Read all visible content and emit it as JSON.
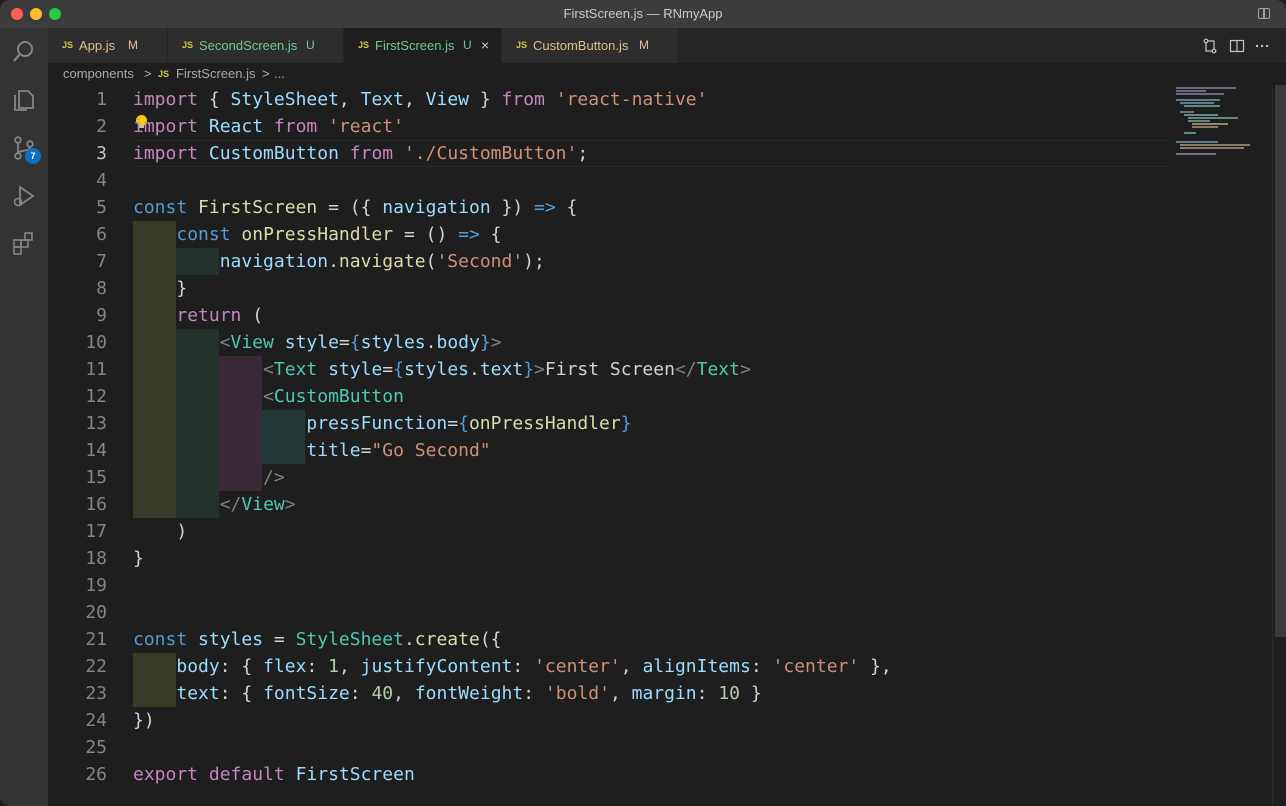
{
  "window": {
    "title": "FirstScreen.js — RNmyApp"
  },
  "activity_bar": {
    "scm_badge": "7"
  },
  "tabs": [
    {
      "icon": "JS",
      "name": "App.js",
      "status": "M",
      "name_color": "#e2c08d",
      "active": false
    },
    {
      "icon": "JS",
      "name": "SecondScreen.js",
      "status": "U",
      "name_color": "#73c991",
      "active": false
    },
    {
      "icon": "JS",
      "name": "FirstScreen.js",
      "status": "U",
      "name_color": "#73c991",
      "active": true,
      "close": "×"
    },
    {
      "icon": "JS",
      "name": "CustomButton.js",
      "status": "M",
      "name_color": "#e2c08d",
      "active": false
    }
  ],
  "breadcrumb": {
    "folder": "components",
    "sep": ">",
    "file_icon": "JS",
    "file": "FirstScreen.js",
    "ellipsis": "..."
  },
  "editor": {
    "current_line": 3,
    "line_numbers": [
      "1",
      "2",
      "3",
      "4",
      "5",
      "6",
      "7",
      "8",
      "9",
      "10",
      "11",
      "12",
      "13",
      "14",
      "15",
      "16",
      "17",
      "18",
      "19",
      "20",
      "21",
      "22",
      "23",
      "24",
      "25",
      "26"
    ],
    "lines": [
      [
        [
          "kw",
          "import"
        ],
        [
          "p",
          " { "
        ],
        [
          "var",
          "StyleSheet"
        ],
        [
          "p",
          ", "
        ],
        [
          "var",
          "Text"
        ],
        [
          "p",
          ", "
        ],
        [
          "var",
          "View"
        ],
        [
          "p",
          " } "
        ],
        [
          "kw",
          "from"
        ],
        [
          "p",
          " "
        ],
        [
          "str",
          "'react-native'"
        ]
      ],
      [
        [
          "kw",
          "import"
        ],
        [
          "p",
          " "
        ],
        [
          "var",
          "React"
        ],
        [
          "p",
          " "
        ],
        [
          "kw",
          "from"
        ],
        [
          "p",
          " "
        ],
        [
          "str",
          "'react'"
        ]
      ],
      [
        [
          "kw",
          "import"
        ],
        [
          "p",
          " "
        ],
        [
          "var",
          "CustomButton"
        ],
        [
          "p",
          " "
        ],
        [
          "kw",
          "from"
        ],
        [
          "p",
          " "
        ],
        [
          "str",
          "'./CustomButton'"
        ],
        [
          "p",
          ";"
        ]
      ],
      [],
      [
        [
          "decl",
          "const"
        ],
        [
          "p",
          " "
        ],
        [
          "fn",
          "FirstScreen"
        ],
        [
          "p",
          " = ({ "
        ],
        [
          "var",
          "navigation"
        ],
        [
          "p",
          " }) "
        ],
        [
          "decl",
          "=>"
        ],
        [
          "p",
          " {"
        ]
      ],
      [
        [
          "p",
          "    "
        ],
        [
          "decl",
          "const"
        ],
        [
          "p",
          " "
        ],
        [
          "fn",
          "onPressHandler"
        ],
        [
          "p",
          " = () "
        ],
        [
          "decl",
          "=>"
        ],
        [
          "p",
          " {"
        ]
      ],
      [
        [
          "p",
          "        "
        ],
        [
          "var",
          "navigation"
        ],
        [
          "p",
          "."
        ],
        [
          "fn",
          "navigate"
        ],
        [
          "p",
          "("
        ],
        [
          "str",
          "'Second'"
        ],
        [
          "p",
          ");"
        ]
      ],
      [
        [
          "p",
          "    }"
        ]
      ],
      [
        [
          "p",
          "    "
        ],
        [
          "kw",
          "return"
        ],
        [
          "p",
          " ("
        ]
      ],
      [
        [
          "p",
          "        "
        ],
        [
          "brk",
          "<"
        ],
        [
          "tag",
          "View"
        ],
        [
          "p",
          " "
        ],
        [
          "var",
          "style"
        ],
        [
          "p",
          "="
        ],
        [
          "jsb",
          "{"
        ],
        [
          "var",
          "styles"
        ],
        [
          "p",
          "."
        ],
        [
          "var",
          "body"
        ],
        [
          "jsb",
          "}"
        ],
        [
          "brk",
          ">"
        ]
      ],
      [
        [
          "p",
          "            "
        ],
        [
          "brk",
          "<"
        ],
        [
          "tag",
          "Text"
        ],
        [
          "p",
          " "
        ],
        [
          "var",
          "style"
        ],
        [
          "p",
          "="
        ],
        [
          "jsb",
          "{"
        ],
        [
          "var",
          "styles"
        ],
        [
          "p",
          "."
        ],
        [
          "var",
          "text"
        ],
        [
          "jsb",
          "}"
        ],
        [
          "brk",
          ">"
        ],
        [
          "p",
          "First Screen"
        ],
        [
          "brk",
          "</"
        ],
        [
          "tag",
          "Text"
        ],
        [
          "brk",
          ">"
        ]
      ],
      [
        [
          "p",
          "            "
        ],
        [
          "brk",
          "<"
        ],
        [
          "tag",
          "CustomButton"
        ]
      ],
      [
        [
          "p",
          "                "
        ],
        [
          "var",
          "pressFunction"
        ],
        [
          "p",
          "="
        ],
        [
          "jsb",
          "{"
        ],
        [
          "fn",
          "onPressHandler"
        ],
        [
          "jsb",
          "}"
        ]
      ],
      [
        [
          "p",
          "                "
        ],
        [
          "var",
          "title"
        ],
        [
          "p",
          "="
        ],
        [
          "str",
          "\"Go Second\""
        ]
      ],
      [
        [
          "p",
          "            "
        ],
        [
          "brk",
          "/>"
        ]
      ],
      [
        [
          "p",
          "        "
        ],
        [
          "brk",
          "</"
        ],
        [
          "tag",
          "View"
        ],
        [
          "brk",
          ">"
        ]
      ],
      [
        [
          "p",
          "    )"
        ]
      ],
      [
        [
          "p",
          "}"
        ]
      ],
      [],
      [],
      [
        [
          "decl",
          "const"
        ],
        [
          "p",
          " "
        ],
        [
          "var",
          "styles"
        ],
        [
          "p",
          " = "
        ],
        [
          "cls",
          "StyleSheet"
        ],
        [
          "p",
          "."
        ],
        [
          "fn",
          "create"
        ],
        [
          "p",
          "({"
        ]
      ],
      [
        [
          "p",
          "    "
        ],
        [
          "var",
          "body"
        ],
        [
          "p",
          ": { "
        ],
        [
          "var",
          "flex"
        ],
        [
          "p",
          ": "
        ],
        [
          "num",
          "1"
        ],
        [
          "p",
          ", "
        ],
        [
          "var",
          "justifyContent"
        ],
        [
          "p",
          ": "
        ],
        [
          "str",
          "'center'"
        ],
        [
          "p",
          ", "
        ],
        [
          "var",
          "alignItems"
        ],
        [
          "p",
          ": "
        ],
        [
          "str",
          "'center'"
        ],
        [
          "p",
          " },"
        ]
      ],
      [
        [
          "p",
          "    "
        ],
        [
          "var",
          "text"
        ],
        [
          "p",
          ": { "
        ],
        [
          "var",
          "fontSize"
        ],
        [
          "p",
          ": "
        ],
        [
          "num",
          "40"
        ],
        [
          "p",
          ", "
        ],
        [
          "var",
          "fontWeight"
        ],
        [
          "p",
          ": "
        ],
        [
          "str",
          "'bold'"
        ],
        [
          "p",
          ", "
        ],
        [
          "var",
          "margin"
        ],
        [
          "p",
          ": "
        ],
        [
          "num",
          "10"
        ],
        [
          "p",
          " }"
        ]
      ],
      [
        [
          "p",
          "})"
        ]
      ],
      [],
      [
        [
          "kw",
          "export"
        ],
        [
          "p",
          " "
        ],
        [
          "kw",
          "default"
        ],
        [
          "p",
          " "
        ],
        [
          "var",
          "FirstScreen"
        ]
      ]
    ]
  }
}
